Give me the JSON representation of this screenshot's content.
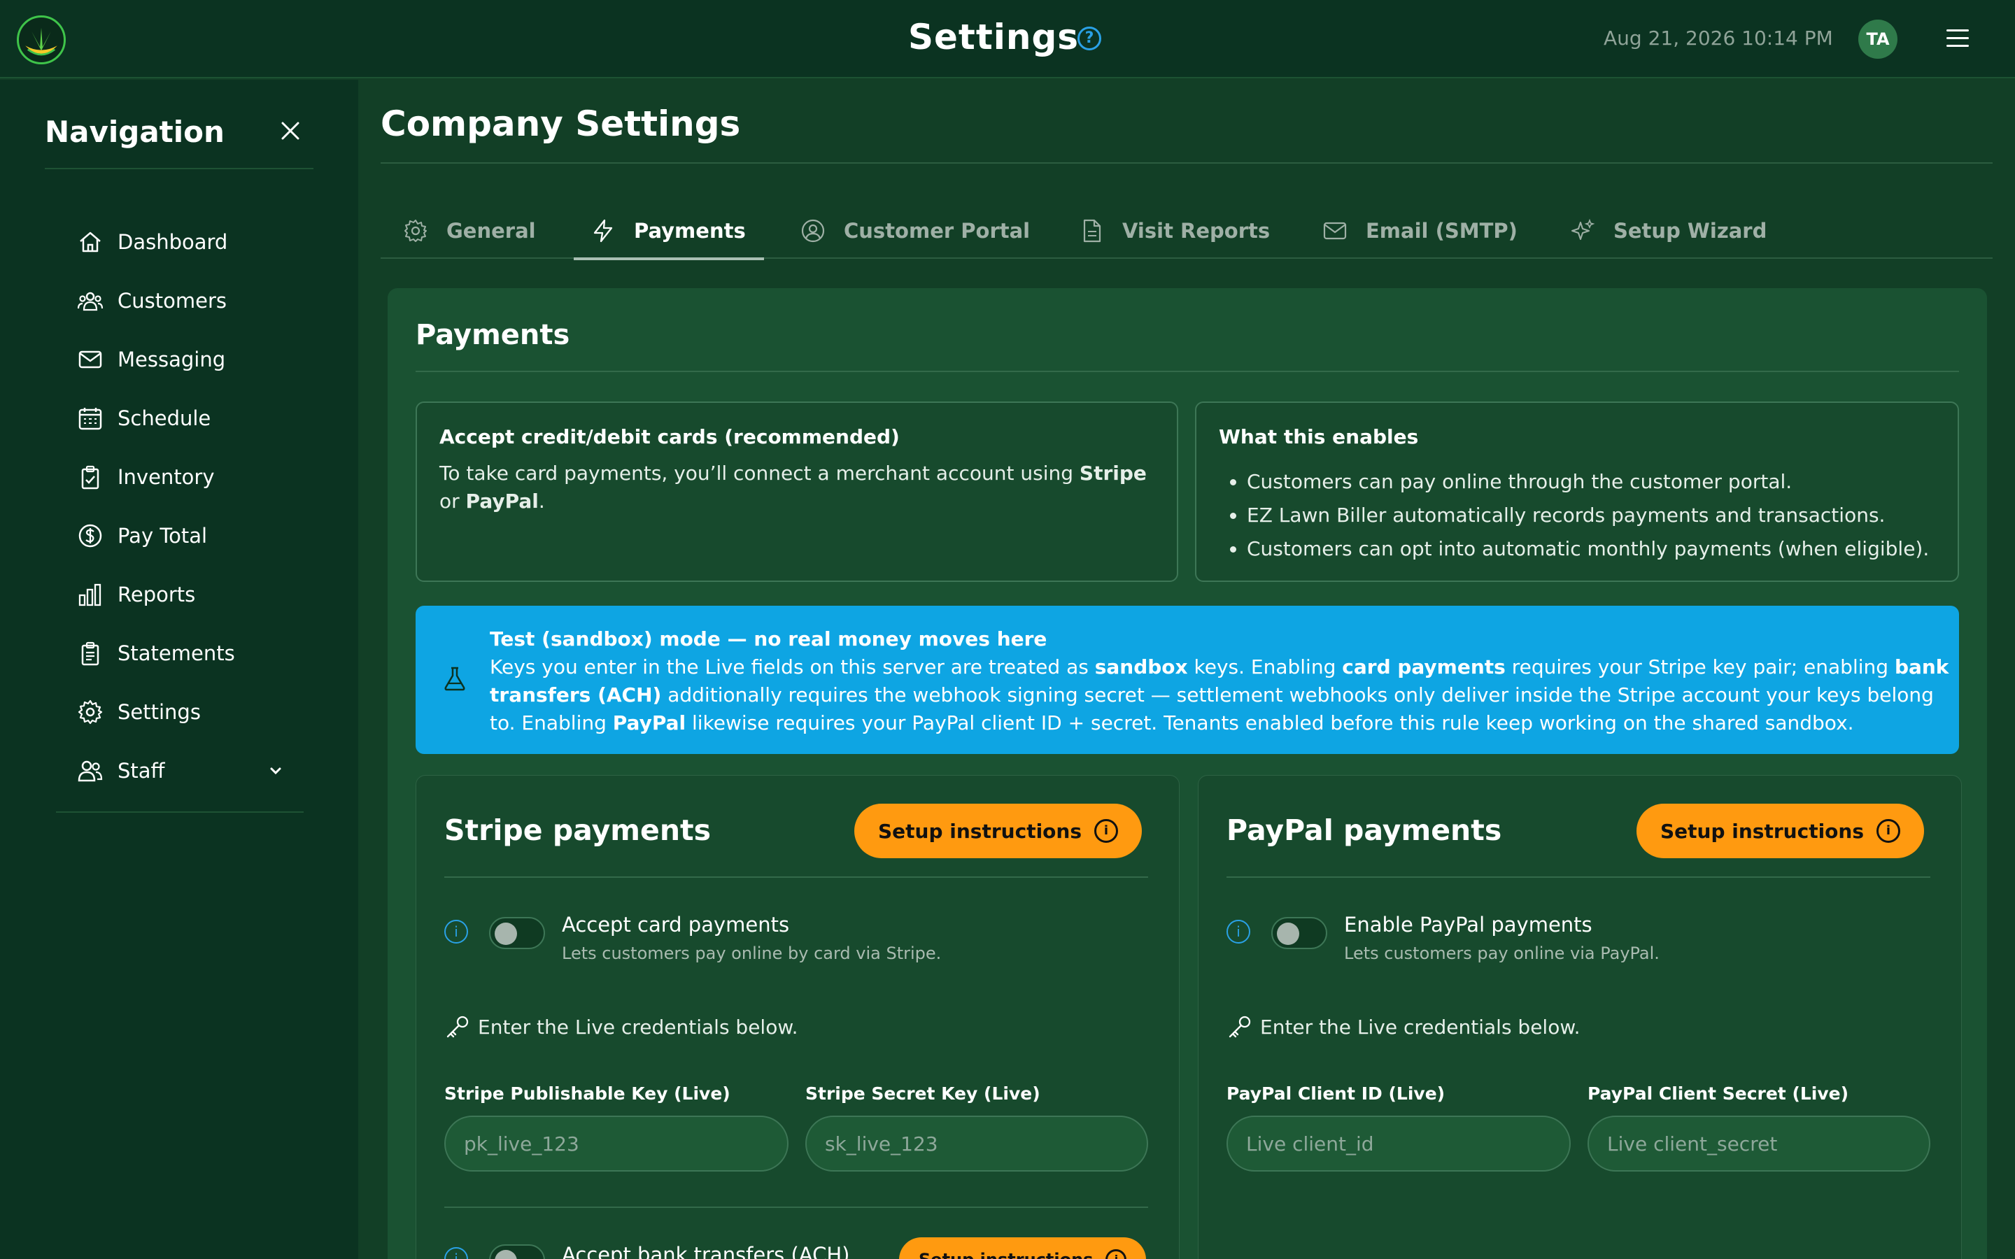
{
  "header": {
    "title": "Settings",
    "datetime": "Aug 21, 2026 10:14 PM",
    "avatar_initials": "TA"
  },
  "sidebar": {
    "title": "Navigation",
    "items": [
      {
        "label": "Dashboard",
        "icon": "home-icon"
      },
      {
        "label": "Customers",
        "icon": "users-icon"
      },
      {
        "label": "Messaging",
        "icon": "mail-icon"
      },
      {
        "label": "Schedule",
        "icon": "calendar-icon"
      },
      {
        "label": "Inventory",
        "icon": "clipboard-check-icon"
      },
      {
        "label": "Pay Total",
        "icon": "dollar-circle-icon"
      },
      {
        "label": "Reports",
        "icon": "bar-chart-icon"
      },
      {
        "label": "Statements",
        "icon": "document-stack-icon"
      },
      {
        "label": "Settings",
        "icon": "gear-icon"
      },
      {
        "label": "Staff",
        "icon": "staff-icon"
      }
    ]
  },
  "main": {
    "title": "Company Settings",
    "tabs": [
      {
        "label": "General",
        "icon": "gear-icon"
      },
      {
        "label": "Payments",
        "icon": "lightning-icon"
      },
      {
        "label": "Customer Portal",
        "icon": "user-circle-icon"
      },
      {
        "label": "Visit Reports",
        "icon": "document-icon"
      },
      {
        "label": "Email (SMTP)",
        "icon": "mail-icon"
      },
      {
        "label": "Setup Wizard",
        "icon": "sparkles-icon"
      }
    ],
    "active_tab": "Payments"
  },
  "payments": {
    "title": "Payments",
    "accept_card": {
      "heading": "Accept credit/debit cards (recommended)",
      "text_1": "To take card payments, you’ll connect a merchant account using ",
      "stripe": "Stripe",
      "text_2": " or ",
      "paypal": "PayPal",
      "text_3": "."
    },
    "enables": {
      "heading": "What this enables",
      "items": [
        "Customers can pay online through the customer portal.",
        "EZ Lawn Biller automatically records payments and transactions.",
        "Customers can opt into automatic monthly payments (when eligible)."
      ]
    },
    "sandbox": {
      "heading": "Test (sandbox) mode — no real money moves here",
      "t1": "Keys you enter in the Live fields on this server are treated as ",
      "b1": "sandbox",
      "t2": " keys. Enabling ",
      "b2": "card payments",
      "t3": " requires your Stripe key pair; enabling ",
      "b3": "bank transfers (ACH)",
      "t4": " additionally requires the webhook signing secret — settlement webhooks only deliver inside the Stripe account your keys belong to. Enabling ",
      "b4": "PayPal",
      "t5": " likewise requires your PayPal client ID + secret. Tenants enabled before this rule keep working on the shared sandbox."
    },
    "stripe": {
      "title": "Stripe payments",
      "setup_label": "Setup instructions",
      "toggle_label": "Accept card payments",
      "toggle_sub": "Lets customers pay online by card via Stripe.",
      "cred_note": "Enter the Live credentials below.",
      "field1_label": "Stripe Publishable Key (Live)",
      "field1_placeholder": "pk_live_123",
      "field2_label": "Stripe Secret Key (Live)",
      "field2_placeholder": "sk_live_123",
      "ach_label": "Accept bank transfers (ACH)",
      "ach_setup_label": "Setup instructions"
    },
    "paypal": {
      "title": "PayPal payments",
      "setup_label": "Setup instructions",
      "toggle_label": "Enable PayPal payments",
      "toggle_sub": "Lets customers pay online via PayPal.",
      "cred_note": "Enter the Live credentials below.",
      "field1_label": "PayPal Client ID (Live)",
      "field1_placeholder": "Live client_id",
      "field2_label": "PayPal Client Secret (Live)",
      "field2_placeholder": "Live client_secret"
    }
  },
  "colors": {
    "background": "#123f26",
    "topbar": "#0b3321",
    "accent_orange": "#ff9a10",
    "info_blue": "#0ea5e3",
    "help_blue": "#2aa1e6"
  }
}
